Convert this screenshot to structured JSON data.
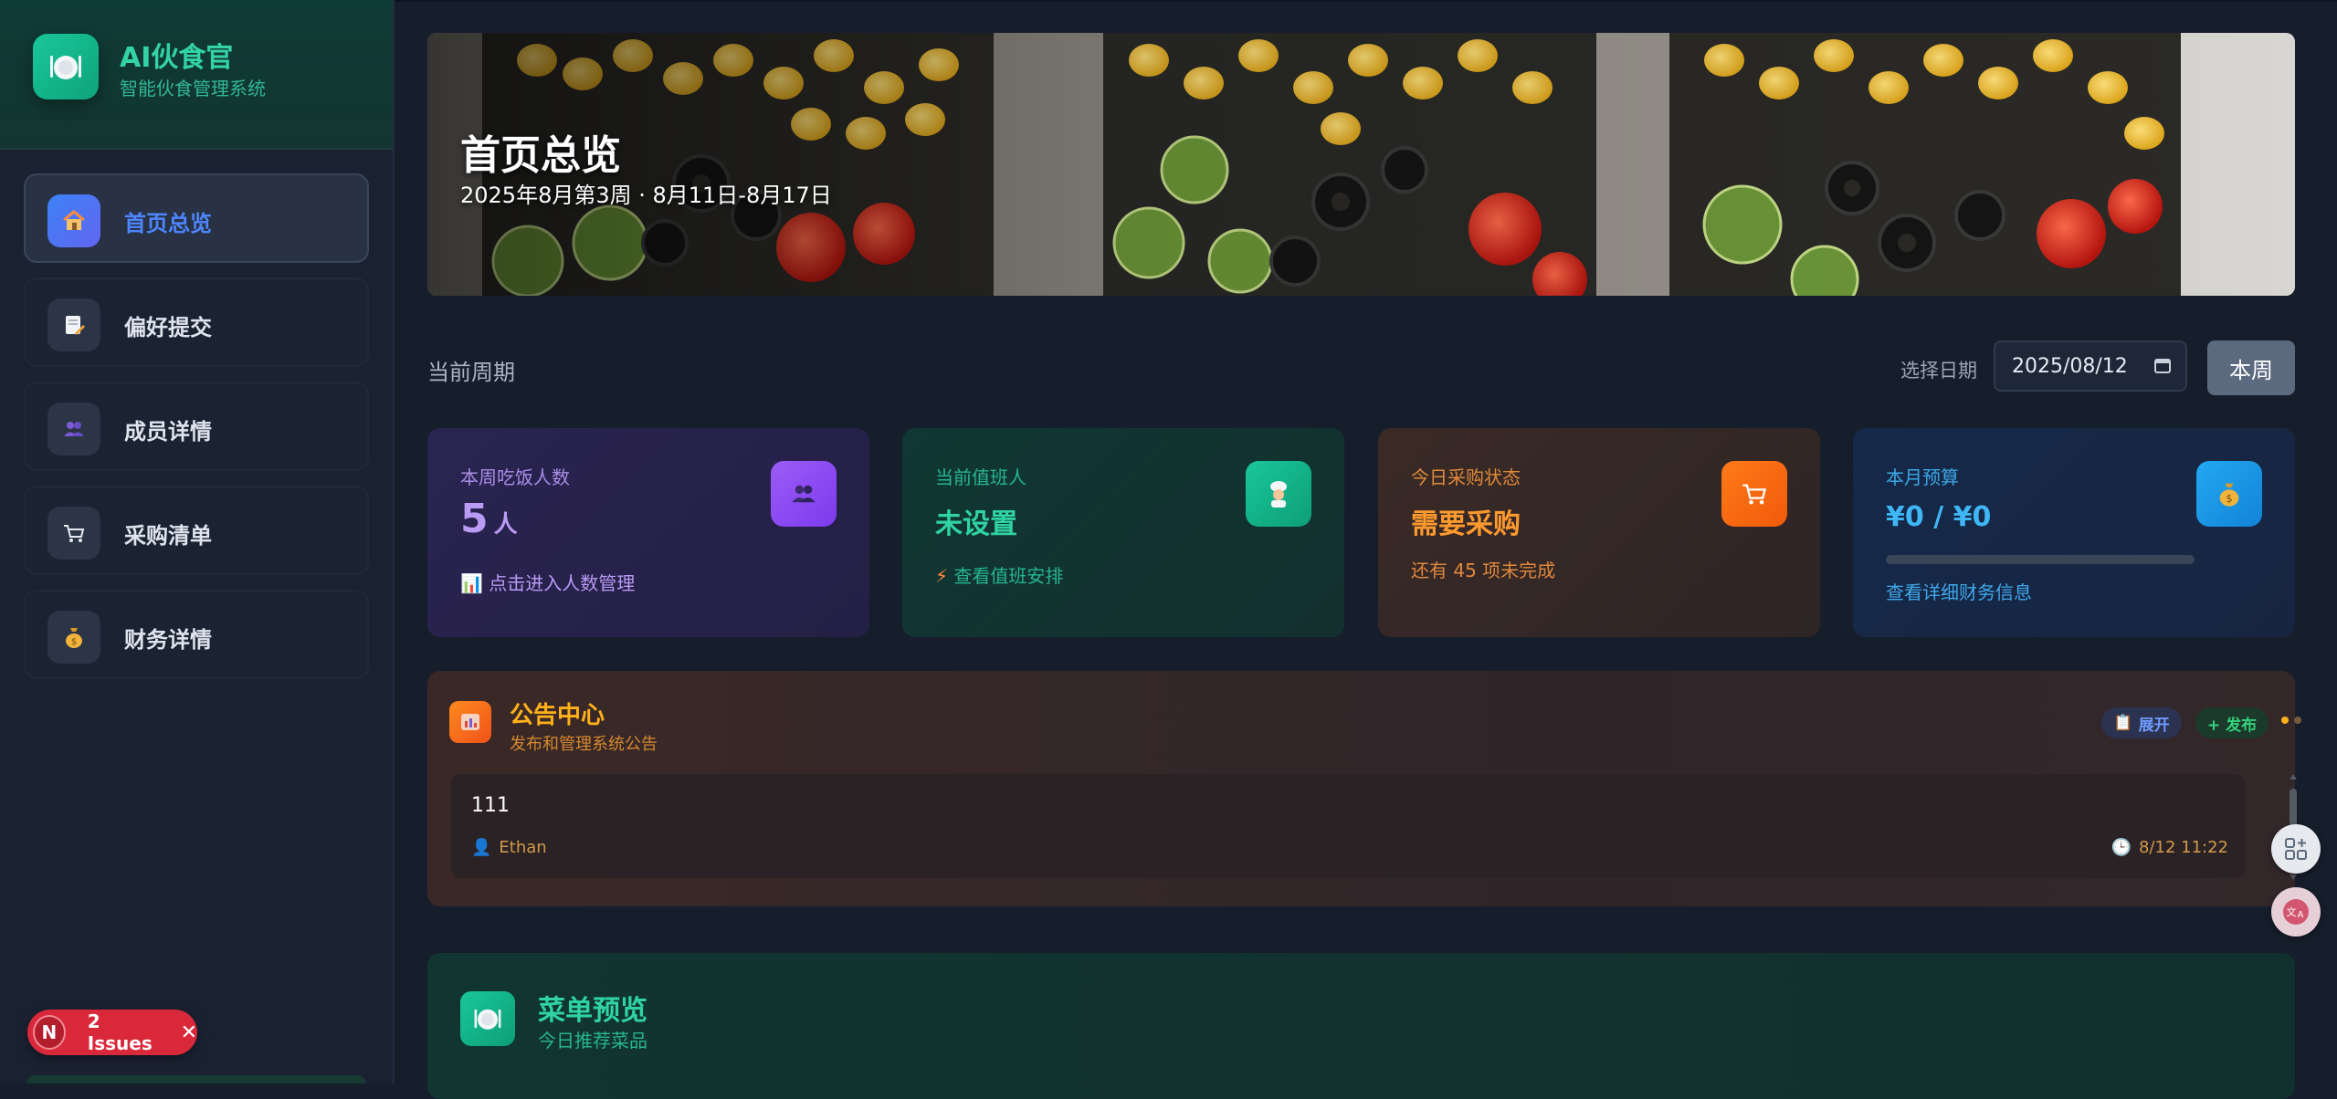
{
  "app": {
    "name": "AI伙食官",
    "subtitle": "智能伙食管理系统"
  },
  "sidebar": {
    "items": [
      {
        "label": "首页总览",
        "icon": "house-icon",
        "active": true
      },
      {
        "label": "偏好提交",
        "icon": "memo-icon",
        "active": false
      },
      {
        "label": "成员详情",
        "icon": "people-icon",
        "active": false
      },
      {
        "label": "采购清单",
        "icon": "cart-icon",
        "active": false
      },
      {
        "label": "财务详情",
        "icon": "money-bag-icon",
        "active": false
      }
    ]
  },
  "dev_overlay": {
    "badge": "N",
    "label": "2 Issues"
  },
  "hero": {
    "title": "首页总览",
    "subtitle": "2025年8月第3周 · 8月11日-8月17日"
  },
  "period": {
    "label": "当前周期",
    "date_label": "选择日期",
    "date_value": "2025/08/12",
    "this_week_button": "本周"
  },
  "cards": {
    "diners": {
      "label": "本周吃饭人数",
      "value": "5",
      "unit": "人",
      "link": "点击进入人数管理"
    },
    "duty": {
      "label": "当前值班人",
      "value": "未设置",
      "link": "查看值班安排"
    },
    "purchase": {
      "label": "今日采购状态",
      "value": "需要采购",
      "detail": "还有 45 项未完成"
    },
    "budget": {
      "label": "本月预算",
      "value": "¥0 / ¥0",
      "progress": 0,
      "link": "查看详细财务信息"
    }
  },
  "notice": {
    "title": "公告中心",
    "subtitle": "发布和管理系统公告",
    "expand_button": "展开",
    "publish_button": "+ 发布",
    "items": [
      {
        "text": "111",
        "author": "Ethan",
        "time": "8/12 11:22"
      }
    ]
  },
  "menu": {
    "title": "菜单预览",
    "subtitle": "今日推荐菜品"
  },
  "colors": {
    "accent_green": "#2fd3a4",
    "accent_blue": "#4e86ff",
    "accent_orange": "#ff9a2e",
    "accent_purple": "#b99af4",
    "accent_sky": "#3fb7f6"
  }
}
